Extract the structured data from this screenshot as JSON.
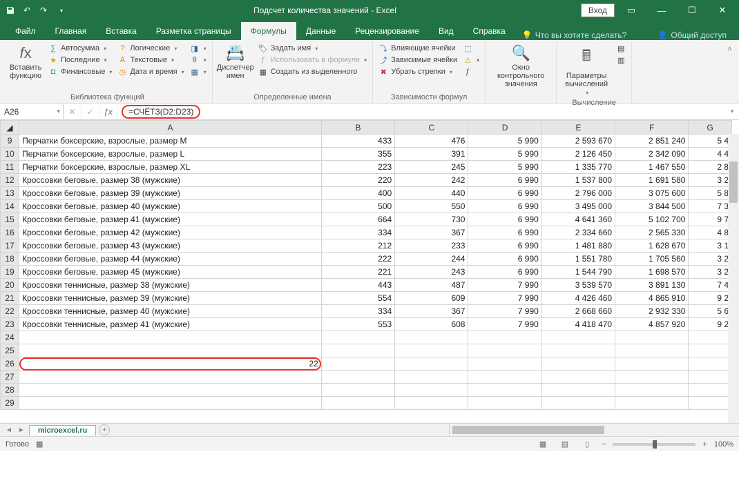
{
  "title": "Подсчет количества значений  -  Excel",
  "login_btn": "Вход",
  "tabs": {
    "file": "Файл",
    "home": "Главная",
    "insert": "Вставка",
    "layout": "Разметка страницы",
    "formulas": "Формулы",
    "data": "Данные",
    "review": "Рецензирование",
    "view": "Вид",
    "help": "Справка",
    "tell_me": "Что вы хотите сделать?",
    "share": "Общий доступ"
  },
  "ribbon": {
    "insert_fn": "Вставить функцию",
    "autosum": "Автосумма",
    "recent": "Последние",
    "financial": "Финансовые",
    "logical": "Логические",
    "text": "Текстовые",
    "datetime": "Дата и время",
    "lib_label": "Библиотека функций",
    "name_mgr": "Диспетчер имен",
    "define_name": "Задать имя",
    "use_in_formula": "Использовать в формуле",
    "create_from": "Создать из выделенного",
    "defined_names": "Определенные имена",
    "trace_prec": "Влияющие ячейки",
    "trace_dep": "Зависимые ячейки",
    "remove_arrows": "Убрать стрелки",
    "deps_label": "Зависимости формул",
    "watch": "Окно контрольного значения",
    "calc_opts": "Параметры вычислений",
    "calc_label": "Вычисление"
  },
  "name_box": "A26",
  "formula": "=СЧЁТЗ(D2:D23)",
  "columns": [
    "A",
    "B",
    "C",
    "D",
    "E",
    "F",
    "G"
  ],
  "rows": [
    {
      "n": 9,
      "a": "Перчатки боксерские, взрослые, размер M",
      "b": "433",
      "c": "476",
      "d": "5 990",
      "e": "2 593 670",
      "f": "2 851 240",
      "g": "5 4"
    },
    {
      "n": 10,
      "a": "Перчатки боксерские, взрослые, размер L",
      "b": "355",
      "c": "391",
      "d": "5 990",
      "e": "2 126 450",
      "f": "2 342 090",
      "g": "4 4"
    },
    {
      "n": 11,
      "a": "Перчатки боксерские, взрослые, размер XL",
      "b": "223",
      "c": "245",
      "d": "5 990",
      "e": "1 335 770",
      "f": "1 467 550",
      "g": "2 8"
    },
    {
      "n": 12,
      "a": "Кроссовки беговые, размер 38 (мужские)",
      "b": "220",
      "c": "242",
      "d": "6 990",
      "e": "1 537 800",
      "f": "1 691 580",
      "g": "3 2"
    },
    {
      "n": 13,
      "a": "Кроссовки беговые, размер 39 (мужские)",
      "b": "400",
      "c": "440",
      "d": "6 990",
      "e": "2 796 000",
      "f": "3 075 600",
      "g": "5 8"
    },
    {
      "n": 14,
      "a": "Кроссовки беговые, размер 40 (мужские)",
      "b": "500",
      "c": "550",
      "d": "6 990",
      "e": "3 495 000",
      "f": "3 844 500",
      "g": "7 3"
    },
    {
      "n": 15,
      "a": "Кроссовки беговые, размер 41 (мужские)",
      "b": "664",
      "c": "730",
      "d": "6 990",
      "e": "4 641 360",
      "f": "5 102 700",
      "g": "9 7"
    },
    {
      "n": 16,
      "a": "Кроссовки беговые, размер 42 (мужские)",
      "b": "334",
      "c": "367",
      "d": "6 990",
      "e": "2 334 660",
      "f": "2 565 330",
      "g": "4 8"
    },
    {
      "n": 17,
      "a": "Кроссовки беговые, размер 43 (мужские)",
      "b": "212",
      "c": "233",
      "d": "6 990",
      "e": "1 481 880",
      "f": "1 628 670",
      "g": "3 1"
    },
    {
      "n": 18,
      "a": "Кроссовки беговые, размер 44 (мужские)",
      "b": "222",
      "c": "244",
      "d": "6 990",
      "e": "1 551 780",
      "f": "1 705 560",
      "g": "3 2"
    },
    {
      "n": 19,
      "a": "Кроссовки беговые, размер 45 (мужские)",
      "b": "221",
      "c": "243",
      "d": "6 990",
      "e": "1 544 790",
      "f": "1 698 570",
      "g": "3 2"
    },
    {
      "n": 20,
      "a": "Кроссовки теннисные, размер 38 (мужские)",
      "b": "443",
      "c": "487",
      "d": "7 990",
      "e": "3 539 570",
      "f": "3 891 130",
      "g": "7 4"
    },
    {
      "n": 21,
      "a": "Кроссовки теннисные, размер 39 (мужские)",
      "b": "554",
      "c": "609",
      "d": "7 990",
      "e": "4 426 460",
      "f": "4 865 910",
      "g": "9 2"
    },
    {
      "n": 22,
      "a": "Кроссовки теннисные, размер 40 (мужские)",
      "b": "334",
      "c": "367",
      "d": "7 990",
      "e": "2 668 660",
      "f": "2 932 330",
      "g": "5 6"
    },
    {
      "n": 23,
      "a": "Кроссовки теннисные, размер 41 (мужские)",
      "b": "553",
      "c": "608",
      "d": "7 990",
      "e": "4 418 470",
      "f": "4 857 920",
      "g": "9 2"
    }
  ],
  "empty_rows": [
    24,
    25
  ],
  "result_row": {
    "n": 26,
    "a": "22"
  },
  "trailing_rows": [
    27,
    28,
    29
  ],
  "watermark": "microexcel.ru",
  "sheet_tab": "microexcel.ru",
  "status": "Готово",
  "zoom": "100%"
}
